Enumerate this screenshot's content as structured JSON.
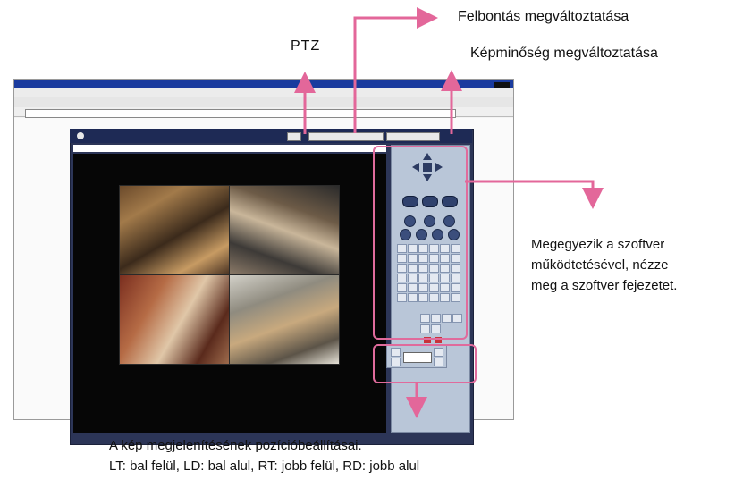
{
  "callouts": {
    "felbontas": "Felbontás megváltoztatása",
    "ptz": "PTZ",
    "kepminoseg": "Képminőség megváltoztatása",
    "software_line1": "Megegyezik a szoftver",
    "software_line2": "működtetésével, nézze",
    "software_line3": "meg a szoftver fejezetet.",
    "position_line1": "A kép megjelenítésének pozícióbeállításai.",
    "position_line2": "LT: bal felül, LD: bal alul, RT: jobb felül, RD: jobb alul"
  },
  "colors": {
    "arrow": "#e3679a",
    "panel": "#b9c6d8",
    "app_frame": "#2c3557"
  },
  "icons": {
    "arrows": "pink-callout-arrows",
    "ptz_pad": "direction-pad-icon"
  }
}
